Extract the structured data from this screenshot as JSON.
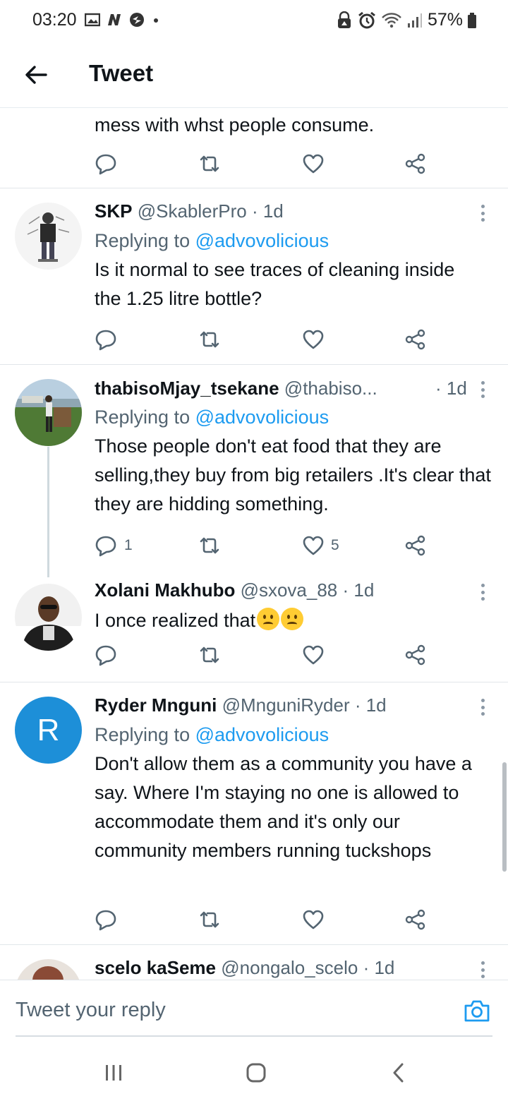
{
  "status_bar": {
    "time": "03:20",
    "battery": "57%"
  },
  "header": {
    "title": "Tweet"
  },
  "top_tweet": {
    "text": "mess with whst people consume."
  },
  "replies": [
    {
      "name": "SKP",
      "handle": "@SkablerPro",
      "time": "· 1d",
      "replying_prefix": "Replying to",
      "replying_to": "@advovolicious",
      "text": "Is it normal to see traces of cleaning inside the 1.25 litre bottle?"
    },
    {
      "name": "thabisoMjay_tsekane",
      "handle": "@thabiso...",
      "time": "· 1d",
      "replying_prefix": "Replying to",
      "replying_to": "@advovolicious",
      "text": "Those people don't eat food that they are selling,they buy from big retailers .It's clear that they are hidding something.",
      "reply_count": "1",
      "like_count": "5"
    },
    {
      "name": "Xolani Makhubo",
      "handle": "@sxova_88",
      "time": "· 1d",
      "text": "I once realized that"
    },
    {
      "name": "Ryder Mnguni",
      "handle": "@MnguniRyder",
      "time": "· 1d",
      "avatar_letter": "R",
      "avatar_color": "#1d8fd8",
      "replying_prefix": "Replying to",
      "replying_to": "@advovolicious",
      "text": "Don't allow them as a community you have a say. Where I'm staying no one is allowed to accommodate them and it's only our community members running tuckshops"
    },
    {
      "name": "scelo kaSeme",
      "handle": "@nongalo_scelo",
      "time": "· 1d"
    }
  ],
  "reply_bar": {
    "placeholder": "Tweet your reply"
  },
  "colors": {
    "link": "#1d9bf0",
    "muted": "#536471",
    "divider": "#e1e6ea"
  }
}
